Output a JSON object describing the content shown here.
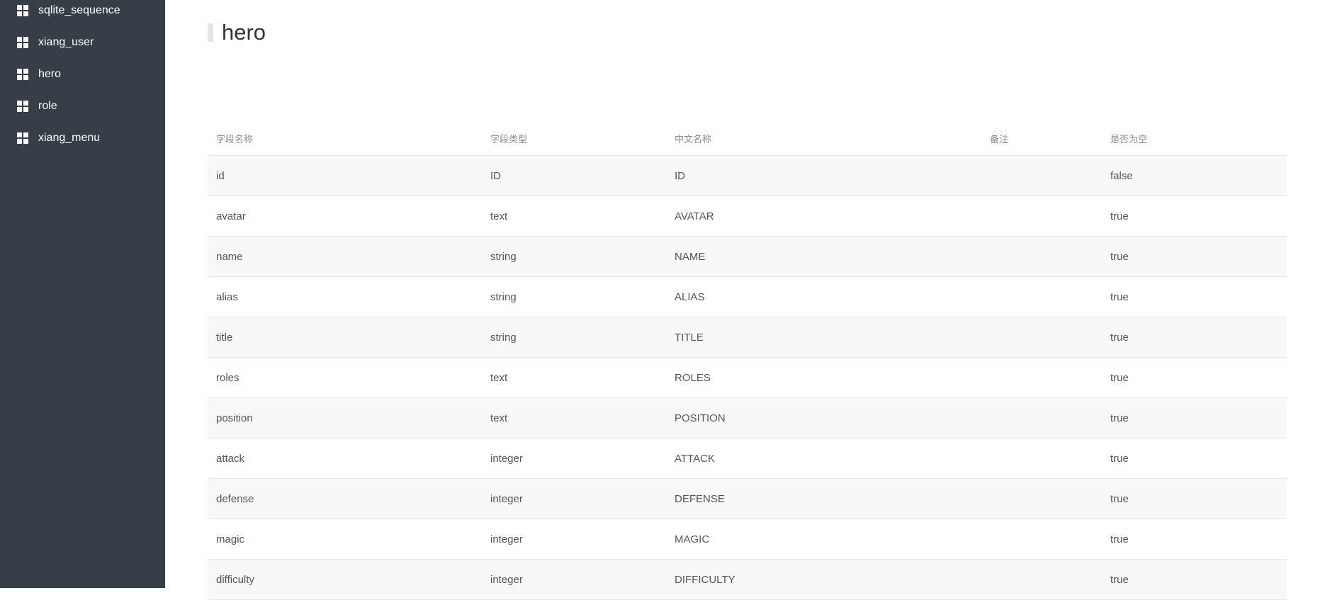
{
  "sidebar": {
    "items": [
      {
        "label": "sqlite_sequence"
      },
      {
        "label": "xiang_user"
      },
      {
        "label": "hero"
      },
      {
        "label": "role"
      },
      {
        "label": "xiang_menu"
      }
    ]
  },
  "page": {
    "title": "hero"
  },
  "table": {
    "headers": [
      "字段名称",
      "字段类型",
      "中文名称",
      "备注",
      "是否为空"
    ],
    "rows": [
      {
        "field": "id",
        "type": "ID",
        "cn_name": "ID",
        "remark": "",
        "nullable": "false"
      },
      {
        "field": "avatar",
        "type": "text",
        "cn_name": "AVATAR",
        "remark": "",
        "nullable": "true"
      },
      {
        "field": "name",
        "type": "string",
        "cn_name": "NAME",
        "remark": "",
        "nullable": "true"
      },
      {
        "field": "alias",
        "type": "string",
        "cn_name": "ALIAS",
        "remark": "",
        "nullable": "true"
      },
      {
        "field": "title",
        "type": "string",
        "cn_name": "TITLE",
        "remark": "",
        "nullable": "true"
      },
      {
        "field": "roles",
        "type": "text",
        "cn_name": "ROLES",
        "remark": "",
        "nullable": "true"
      },
      {
        "field": "position",
        "type": "text",
        "cn_name": "POSITION",
        "remark": "",
        "nullable": "true"
      },
      {
        "field": "attack",
        "type": "integer",
        "cn_name": "ATTACK",
        "remark": "",
        "nullable": "true"
      },
      {
        "field": "defense",
        "type": "integer",
        "cn_name": "DEFENSE",
        "remark": "",
        "nullable": "true"
      },
      {
        "field": "magic",
        "type": "integer",
        "cn_name": "MAGIC",
        "remark": "",
        "nullable": "true"
      },
      {
        "field": "difficulty",
        "type": "integer",
        "cn_name": "DIFFICULTY",
        "remark": "",
        "nullable": "true"
      }
    ]
  }
}
